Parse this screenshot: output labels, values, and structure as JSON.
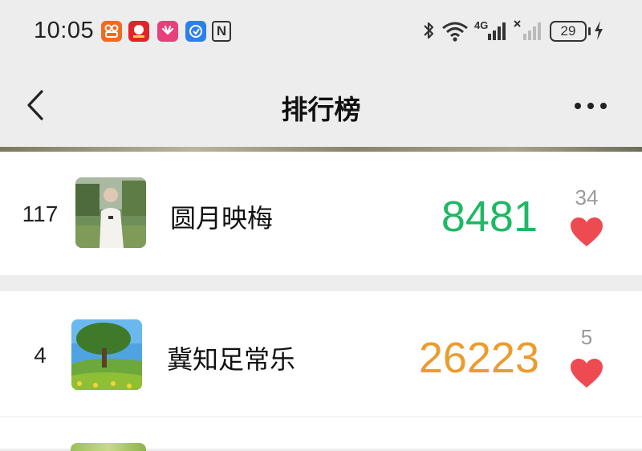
{
  "status_bar": {
    "time": "10:05",
    "app_icons": [
      {
        "name": "app-icon-orange",
        "color": "#f26b21"
      },
      {
        "name": "app-icon-red",
        "color": "#e0242a"
      },
      {
        "name": "app-icon-huawei",
        "color": "#e8407a"
      },
      {
        "name": "app-icon-blue",
        "color": "#2d7ff0"
      }
    ],
    "nfc_label": "N",
    "network_label": "4G",
    "battery_level": "29"
  },
  "navbar": {
    "title": "排行榜"
  },
  "rankings": [
    {
      "rank": "117",
      "name": "圆月映梅",
      "score": "8481",
      "score_color": "#1fb864",
      "likes": "34"
    },
    {
      "rank": "4",
      "name": "冀知足常乐",
      "score": "26223",
      "score_color": "#eb9c2e",
      "likes": "5"
    }
  ],
  "colors": {
    "heart": "#ee4a52",
    "background": "#ededed"
  }
}
